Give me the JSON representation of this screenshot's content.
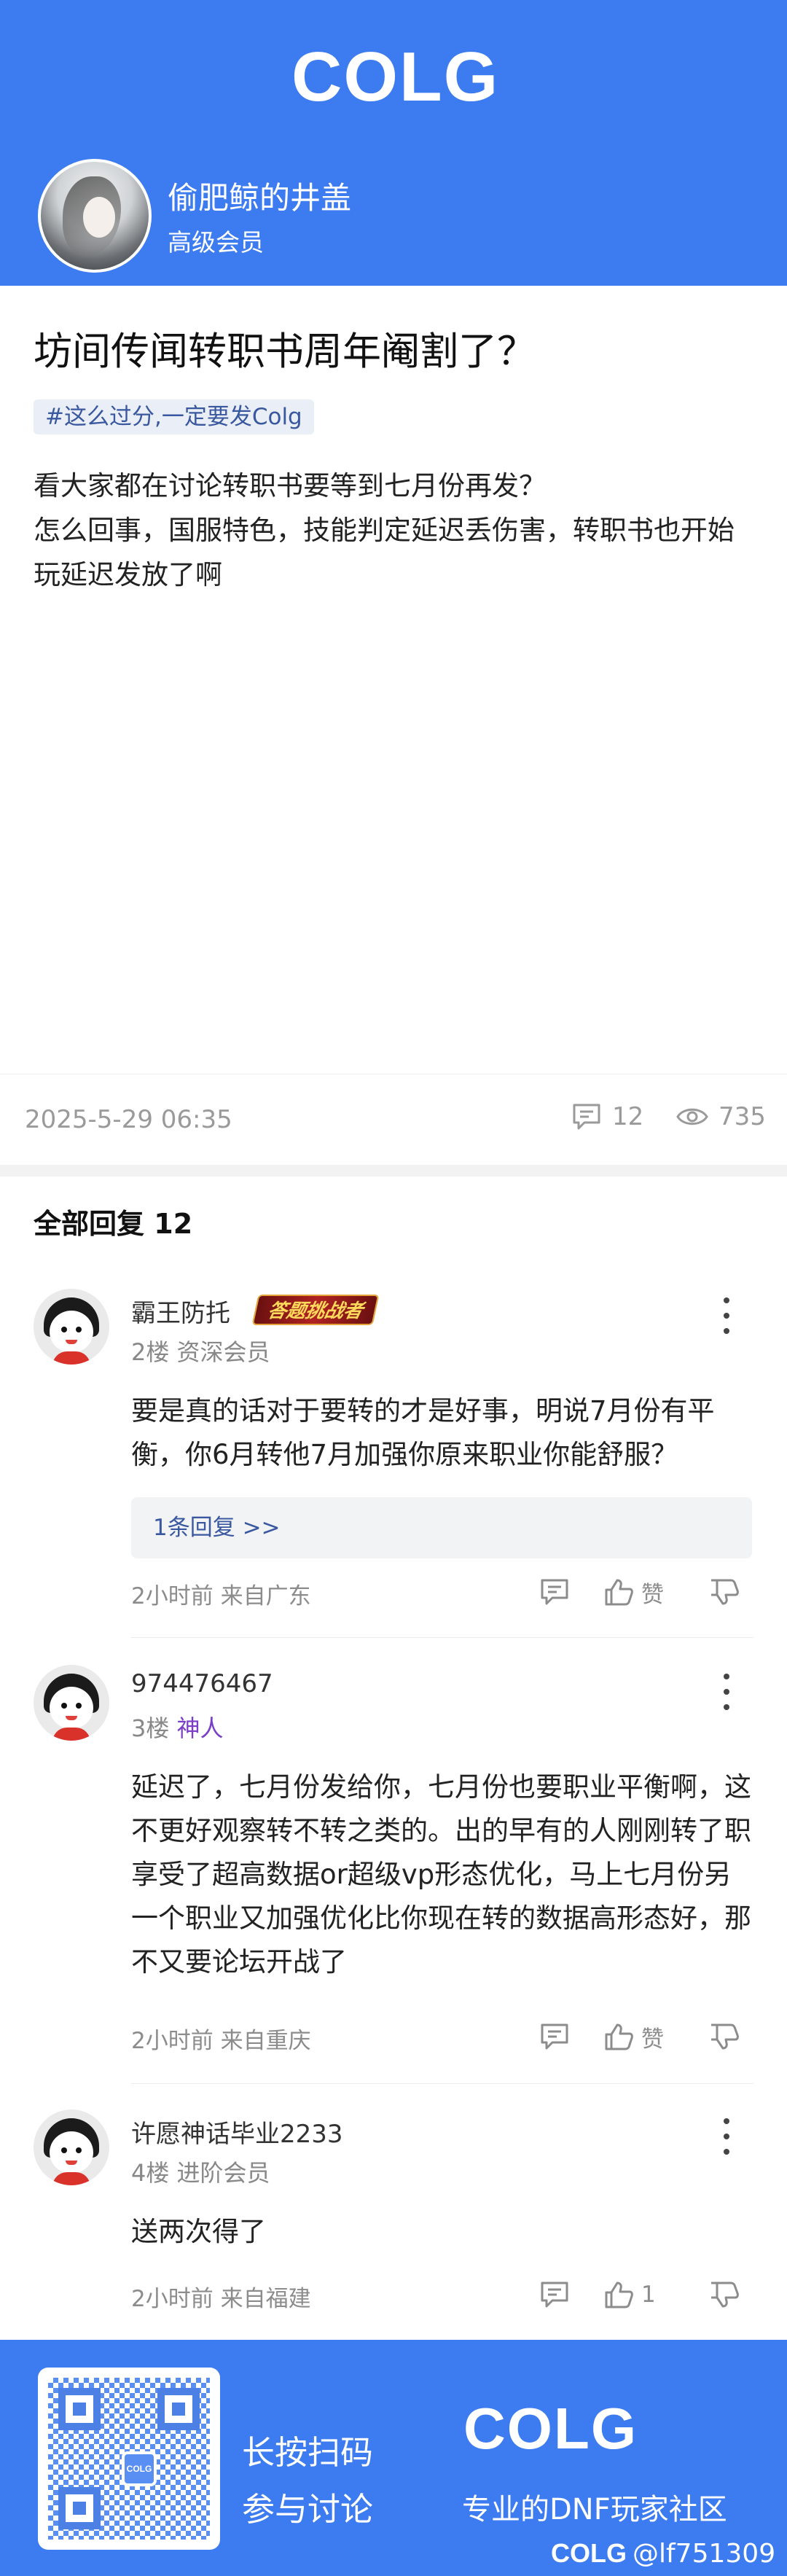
{
  "header": {
    "logo": "COLG",
    "author_name": "偷肥鲸的井盖",
    "author_rank": "高级会员"
  },
  "post": {
    "title": "坊间传闻转职书周年阉割了？",
    "tag": "#这么过分,一定要发Colg",
    "body_lines": [
      "看大家都在讨论转职书要等到七月份再发？",
      "怎么回事，国服特色，技能判定延迟丢伤害，转职书也开始玩延迟发放了啊"
    ],
    "time": "2025-5-29 06:35",
    "comment_count": "12",
    "view_count": "735"
  },
  "replies_header": {
    "label": "全部回复",
    "count": "12"
  },
  "replies": [
    {
      "name": "霸王防托",
      "badge": "答题挑战者",
      "floor": "2楼",
      "rank": "资深会员",
      "text": "要是真的话对于要转的才是好事，明说7月份有平衡，你6月转他7月加强你原来职业你能舒服？",
      "sub_replies": "1条回复 >>",
      "time": "2小时前",
      "location": "来自广东",
      "like_label": "赞"
    },
    {
      "name": "974476467",
      "floor": "3楼",
      "rank": "神人",
      "text": "延迟了，七月份发给你，七月份也要职业平衡啊，这不更好观察转不转之类的。出的早有的人刚刚转了职享受了超高数据or超级vp形态优化，马上七月份另一个职业又加强优化比你现在转的数据高形态好，那不又要论坛开战了",
      "time": "2小时前",
      "location": "来自重庆",
      "like_label": "赞"
    },
    {
      "name": "许愿神话毕业2233",
      "floor": "4楼",
      "rank": "进阶会员",
      "text": "送两次得了",
      "time": "2小时前",
      "location": "来自福建",
      "like_label": "1"
    }
  ],
  "footer": {
    "qr_logo": "COLG",
    "scan_line1": "长按扫码",
    "scan_line2": "参与讨论",
    "logo": "COLG",
    "slogan": "专业的DNF玩家社区",
    "watermark_logo": "COLG",
    "watermark_user": "@lf751309"
  },
  "colors": {
    "brand_blue": "#3d7bf0",
    "link_blue": "#3a58a0",
    "rank_purple": "#7a3ec7"
  }
}
